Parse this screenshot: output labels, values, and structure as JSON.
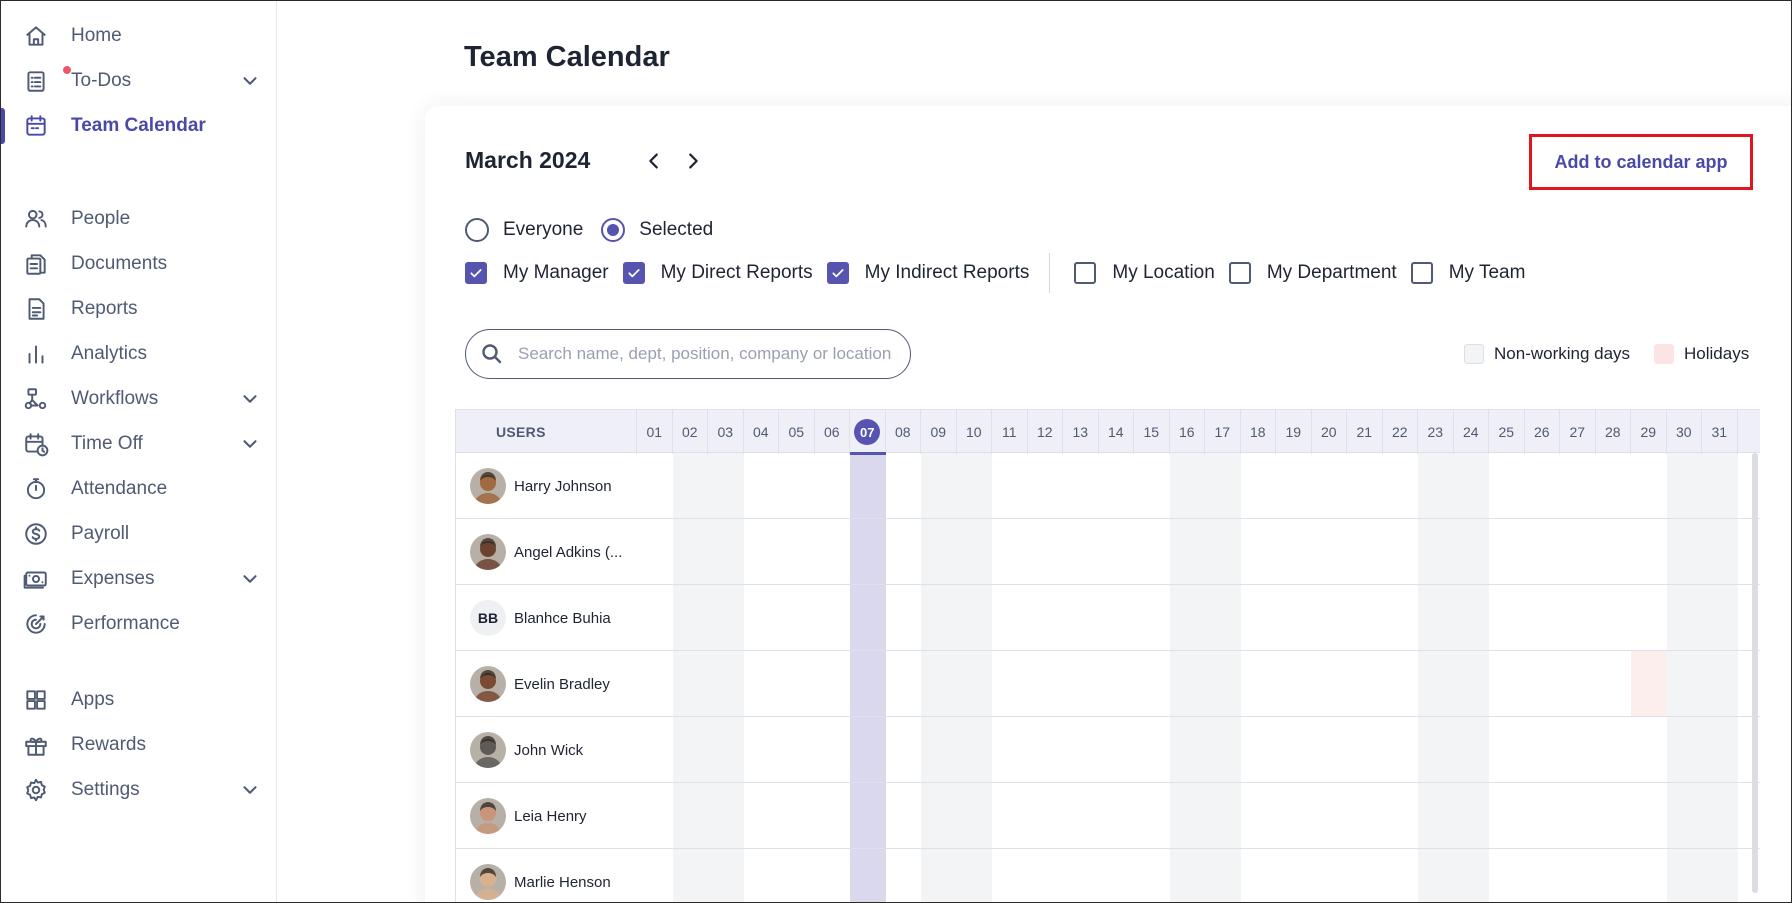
{
  "sidebar": {
    "items": [
      {
        "label": "Home",
        "icon": "home-icon"
      },
      {
        "label": "To-Dos",
        "icon": "todo-list-icon",
        "has_chevron": true,
        "notification": true
      },
      {
        "label": "Team Calendar",
        "icon": "calendar-icon",
        "active": true
      },
      {
        "label": "People",
        "icon": "people-icon"
      },
      {
        "label": "Documents",
        "icon": "documents-icon"
      },
      {
        "label": "Reports",
        "icon": "report-icon"
      },
      {
        "label": "Analytics",
        "icon": "bar-chart-icon"
      },
      {
        "label": "Workflows",
        "icon": "workflow-icon",
        "has_chevron": true
      },
      {
        "label": "Time Off",
        "icon": "calendar-clock-icon",
        "has_chevron": true
      },
      {
        "label": "Attendance",
        "icon": "stopwatch-icon"
      },
      {
        "label": "Payroll",
        "icon": "dollar-circle-icon"
      },
      {
        "label": "Expenses",
        "icon": "money-icon",
        "has_chevron": true
      },
      {
        "label": "Performance",
        "icon": "target-icon"
      },
      {
        "label": "Apps",
        "icon": "apps-grid-icon"
      },
      {
        "label": "Rewards",
        "icon": "gift-icon"
      },
      {
        "label": "Settings",
        "icon": "gear-icon",
        "has_chevron": true
      }
    ]
  },
  "page": {
    "title": "Team Calendar",
    "month": "March 2024",
    "add_button": "Add to calendar app"
  },
  "filters": {
    "radios": [
      {
        "label": "Everyone",
        "selected": false
      },
      {
        "label": "Selected",
        "selected": true
      }
    ],
    "checks_left": [
      {
        "label": "My Manager",
        "checked": true
      },
      {
        "label": "My Direct Reports",
        "checked": true
      },
      {
        "label": "My Indirect Reports",
        "checked": true
      }
    ],
    "checks_right": [
      {
        "label": "My Location",
        "checked": false
      },
      {
        "label": "My Department",
        "checked": false
      },
      {
        "label": "My Team",
        "checked": false
      }
    ]
  },
  "search": {
    "placeholder": "Search name, dept, position, company or location",
    "value": ""
  },
  "legend": {
    "non_working": "Non-working days",
    "holidays": "Holidays",
    "non_working_color": "#f3f4f6",
    "holiday_color": "#fde4e4"
  },
  "calendar": {
    "users_header": "USERS",
    "days": [
      "01",
      "02",
      "03",
      "04",
      "05",
      "06",
      "07",
      "08",
      "09",
      "10",
      "11",
      "12",
      "13",
      "14",
      "15",
      "16",
      "17",
      "18",
      "19",
      "20",
      "21",
      "22",
      "23",
      "24",
      "25",
      "26",
      "27",
      "28",
      "29",
      "30",
      "31"
    ],
    "today": "07",
    "weekend_days": [
      "02",
      "03",
      "09",
      "10",
      "16",
      "17",
      "23",
      "24",
      "30",
      "31"
    ],
    "users": [
      {
        "name": "Harry Johnson",
        "avatar": "photo-avatar",
        "tone": "#a0693f"
      },
      {
        "name": "Angel Adkins (...",
        "avatar": "photo-avatar",
        "tone": "#6b4330"
      },
      {
        "name": "Blanhce Buhia",
        "avatar": "initials-avatar",
        "initials": "BB"
      },
      {
        "name": "Evelin Bradley",
        "avatar": "photo-avatar",
        "tone": "#7a4a32",
        "holiday_days": [
          "29"
        ]
      },
      {
        "name": "John Wick",
        "avatar": "photo-avatar",
        "tone": "#5e5a56"
      },
      {
        "name": "Leia Henry",
        "avatar": "photo-avatar",
        "tone": "#c9957a"
      },
      {
        "name": "Marlie Henson",
        "avatar": "photo-avatar",
        "tone": "#d9b08e"
      }
    ]
  },
  "colors": {
    "accent": "#5654b0",
    "highlight_border": "#e0161e"
  }
}
